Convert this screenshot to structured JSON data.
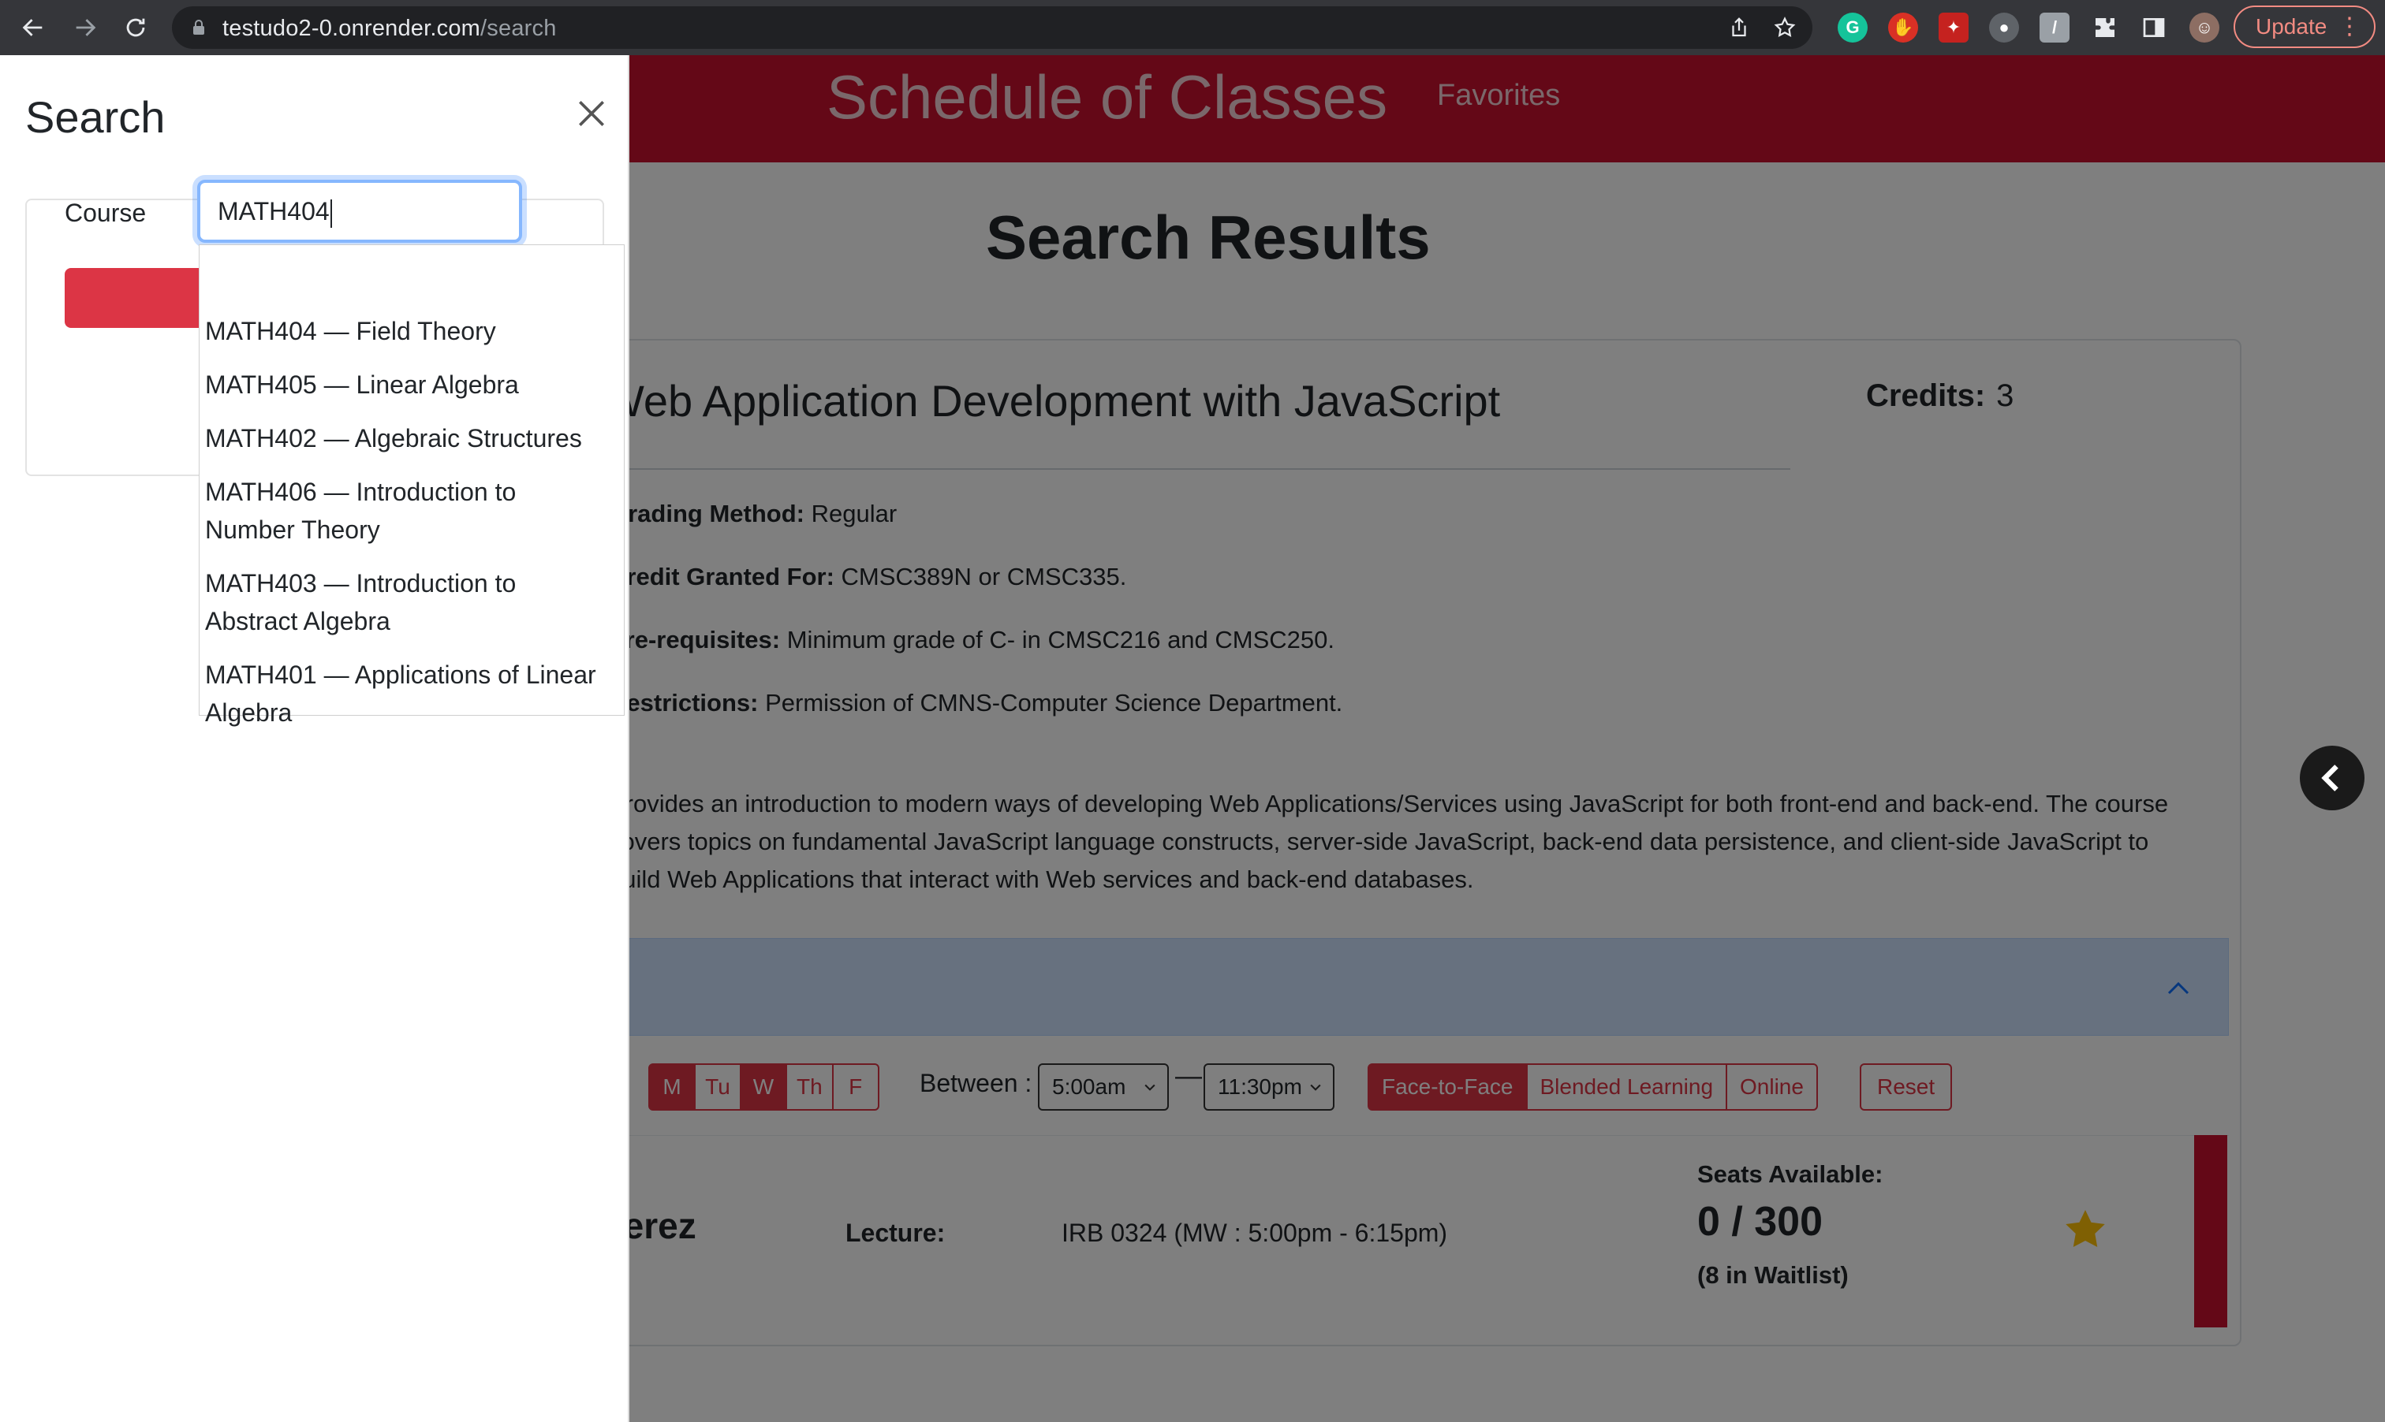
{
  "browser": {
    "url_host": "testudo2-0.onrender.com",
    "url_path": "/search",
    "update_label": "Update",
    "update_menu": "⋮"
  },
  "site": {
    "title": "Schedule of Classes",
    "nav_favorites": "Favorites"
  },
  "results": {
    "heading": "Search Results",
    "course": {
      "title": "Web Application Development with JavaScript",
      "credits_label": "Credits:",
      "credits_value": "3",
      "grading_label": "Grading Method:",
      "grading_value": " Regular",
      "credit_granted_label": "Credit Granted For:",
      "credit_granted_value": " CMSC389N or CMSC335.",
      "prereq_label": "Pre-requisites:",
      "prereq_value": " Minimum grade of C- in CMSC216 and CMSC250.",
      "restrictions_label": "Restrictions:",
      "restrictions_value": " Permission of CMNS-Computer Science Department.",
      "description": "Provides an introduction to modern ways of developing Web Applications/Services using JavaScript for both front-end and back-end. The course covers topics on fundamental JavaScript language constructs, server-side JavaScript, back-end data persistence, and client-side JavaScript to build Web Applications that interact with Web services and back-end databases."
    },
    "filters": {
      "days": [
        "M",
        "Tu",
        "W",
        "Th",
        "F"
      ],
      "days_selected": [
        "M",
        "W"
      ],
      "between_label": "Between :",
      "start_time": "5:00am",
      "end_time": "11:30pm",
      "dash": "—",
      "modes": [
        "Face-to-Face",
        "Blended Learning",
        "Online"
      ],
      "mode_selected": "Face-to-Face",
      "reset_label": "Reset"
    },
    "section": {
      "instructor": "Perez",
      "type_label": "Lecture:",
      "location": "IRB 0324 (MW : 5:00pm - 6:15pm)",
      "seats_label": "Seats Available:",
      "seats_value": "0 / 300",
      "waitlist": "(8 in Waitlist)"
    }
  },
  "search_panel": {
    "title": "Search",
    "course_label": "Course",
    "course_value": "MATH404",
    "suggestions": [
      "MATH404 — Field Theory",
      "MATH405 — Linear Algebra",
      "MATH402 — Algebraic Structures",
      "MATH406 — Introduction to Number Theory",
      "MATH403 — Introduction to Abstract Algebra",
      "MATH401 — Applications of Linear Algebra"
    ]
  },
  "colors": {
    "brand_red": "#c8102e",
    "button_red": "#dc3545",
    "focus_blue": "#86b7fe"
  }
}
